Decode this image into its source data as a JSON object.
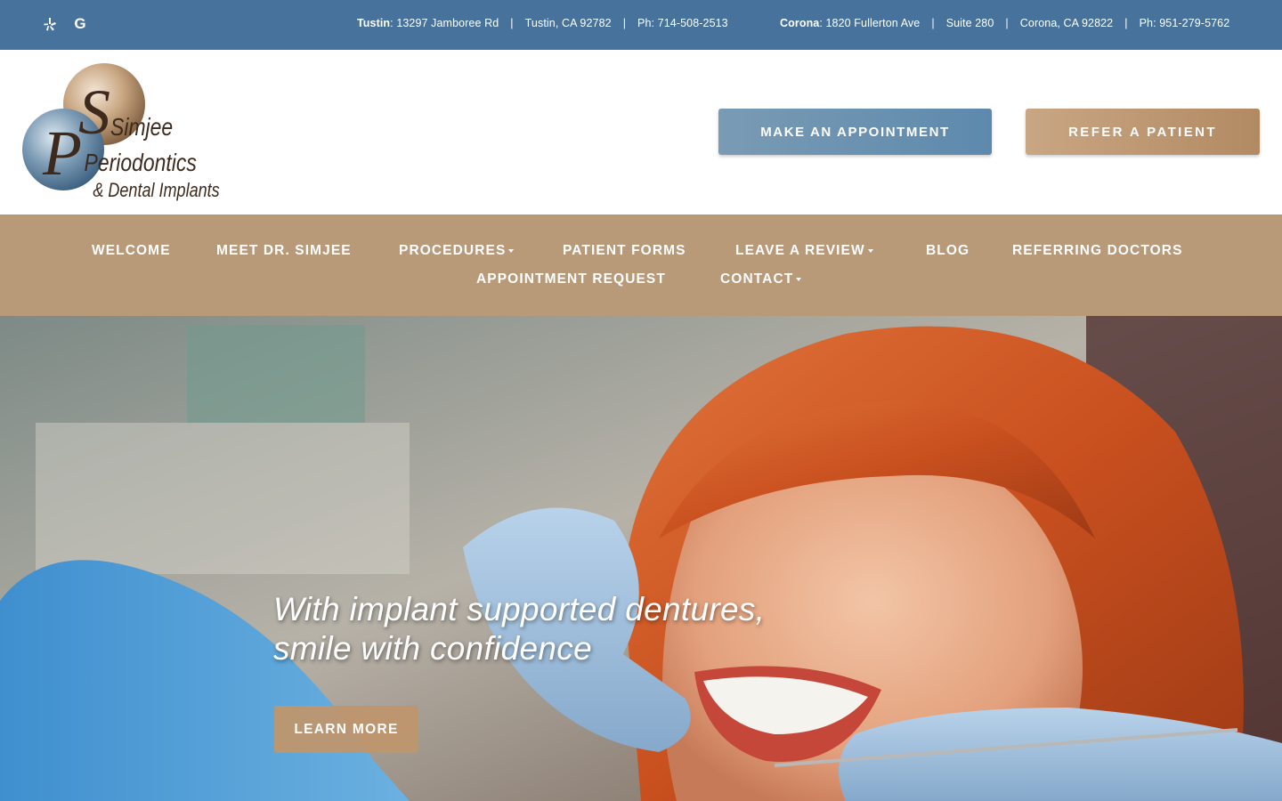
{
  "topbar": {
    "social": [
      {
        "name": "yelp-icon",
        "glyph": "✱"
      },
      {
        "name": "google-icon",
        "glyph": "G"
      }
    ],
    "tustin": {
      "label": "Tustin",
      "street": ": 13297 Jamboree Rd",
      "city": "Tustin, CA 92782",
      "phone": "Ph: 714-508-2513"
    },
    "corona": {
      "label": "Corona",
      "street": ": 1820 Fullerton Ave",
      "suite": "Suite 280",
      "city": "Corona, CA 92822",
      "phone": "Ph: 951-279-5762"
    },
    "separator": "|"
  },
  "header": {
    "logo": {
      "line1": "Simjee",
      "line2": "Periodontics",
      "line3": "& Dental Implants"
    },
    "appointment_button": "MAKE AN APPOINTMENT",
    "refer_button": "REFER A PATIENT"
  },
  "nav": {
    "items": [
      {
        "label": "WELCOME",
        "dropdown": false
      },
      {
        "label": "MEET DR. SIMJEE",
        "dropdown": false
      },
      {
        "label": "PROCEDURES",
        "dropdown": true
      },
      {
        "label": "PATIENT FORMS",
        "dropdown": false
      },
      {
        "label": "LEAVE A REVIEW",
        "dropdown": true
      },
      {
        "label": "BLOG",
        "dropdown": false
      },
      {
        "label": "REFERRING DOCTORS",
        "dropdown": false
      },
      {
        "label": "APPOINTMENT REQUEST",
        "dropdown": false
      },
      {
        "label": "CONTACT",
        "dropdown": true
      }
    ]
  },
  "hero": {
    "title_line1": "With implant supported dentures,",
    "title_line2": "smile with confidence",
    "button": "LEARN MORE"
  },
  "colors": {
    "topbar": "#46729c",
    "nav": "#b99a78",
    "appointment_button": "#6a91b1",
    "refer_button": "#bd9a76"
  }
}
